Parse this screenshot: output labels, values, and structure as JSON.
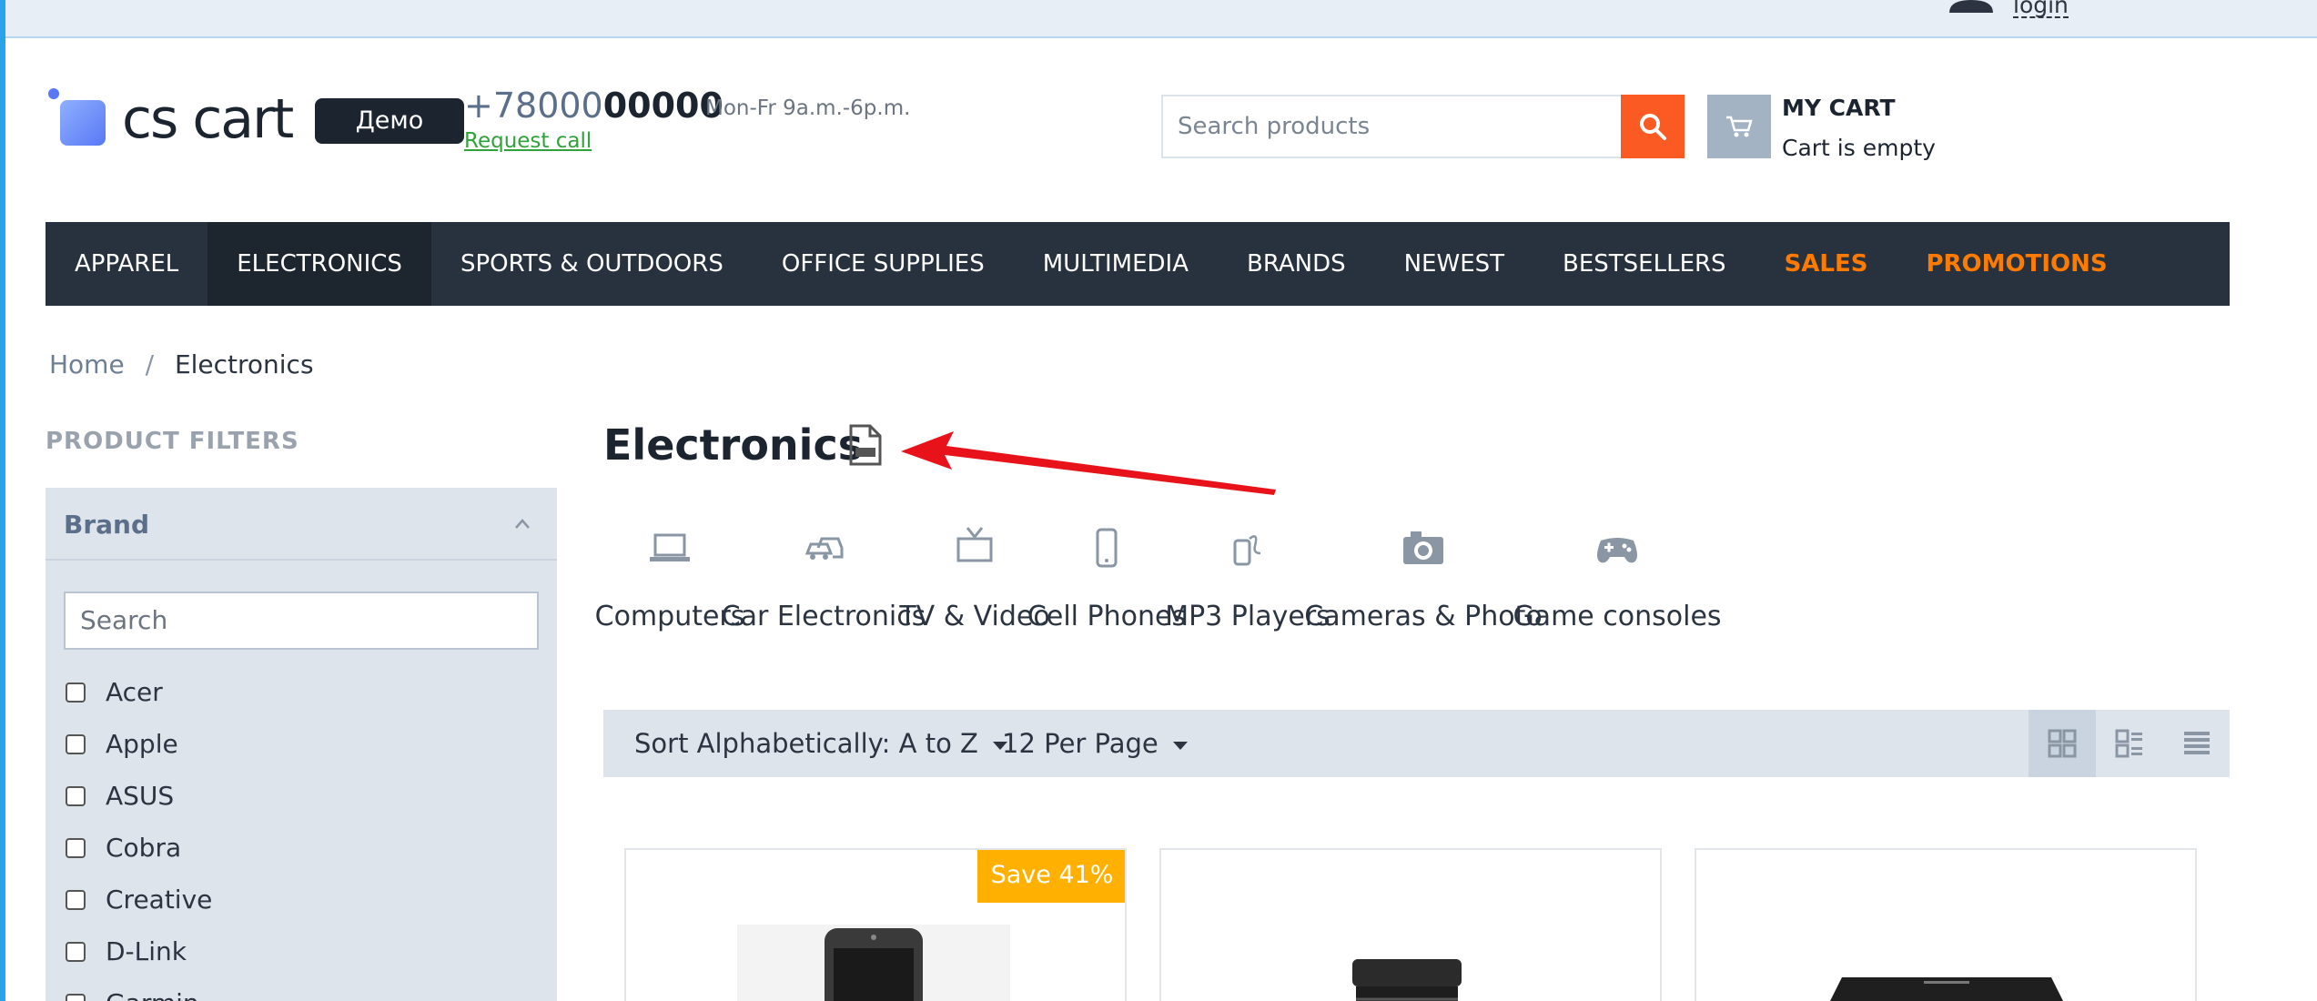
{
  "topbar": {
    "login_label": "login"
  },
  "header": {
    "logo_text": "cs cart",
    "demo_badge": "Демо",
    "phone_prefix": "+78000",
    "phone_bold": "00000",
    "hours": "Mon-Fr 9a.m.-6p.m.",
    "request_call": "Request call",
    "search_placeholder": "Search products",
    "cart_title": "MY CART",
    "cart_status": "Cart is empty"
  },
  "nav": {
    "items": [
      "APPAREL",
      "ELECTRONICS",
      "SPORTS & OUTDOORS",
      "OFFICE SUPPLIES",
      "MULTIMEDIA",
      "BRANDS",
      "NEWEST",
      "BESTSELLERS",
      "SALES",
      "PROMOTIONS"
    ]
  },
  "breadcrumb": {
    "home": "Home",
    "separator": "/",
    "current": "Electronics"
  },
  "filters": {
    "title": "PRODUCT FILTERS",
    "brand_label": "Brand",
    "search_placeholder": "Search",
    "brands": [
      "Acer",
      "Apple",
      "ASUS",
      "Cobra",
      "Creative",
      "D-Link",
      "Garmin"
    ]
  },
  "main": {
    "title": "Electronics",
    "subcategories": [
      {
        "label": "Computers",
        "icon": "laptop-icon"
      },
      {
        "label": "Car Electronics",
        "icon": "car-icon"
      },
      {
        "label": "TV & Video",
        "icon": "tv-icon"
      },
      {
        "label": "Cell Phones",
        "icon": "phone-icon"
      },
      {
        "label": "MP3 Players",
        "icon": "mp3-player-icon"
      },
      {
        "label": "Cameras & Photo",
        "icon": "camera-icon"
      },
      {
        "label": "Game consoles",
        "icon": "gamepad-icon"
      }
    ],
    "sort_label": "Sort Alphabetically: A to Z",
    "per_page_label": "12 Per Page",
    "save_badge": "Save 41%"
  },
  "colors": {
    "nav_bg": "#28323e",
    "accent_orange": "#fb5a22",
    "hot_link": "#ff7b00",
    "badge": "#ffb000"
  }
}
